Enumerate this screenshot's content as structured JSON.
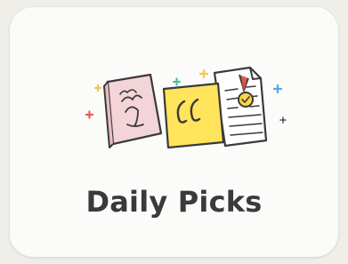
{
  "card": {
    "title": "Daily Picks",
    "icon": "daily-picks-illustration"
  },
  "colors": {
    "background": "#efeee9",
    "card": "#fbfbfa",
    "title": "#3a3a3a",
    "book_pink": "#f3d4d8",
    "quote_yellow": "#ffe45c",
    "doc_white": "#ffffff",
    "seal_yellow": "#f8d547",
    "ribbon_red": "#d85a4e",
    "accent_blue": "#58a9e6",
    "accent_red": "#e65c5a",
    "accent_green": "#4bbfa5",
    "accent_yellow": "#f2c94c"
  }
}
